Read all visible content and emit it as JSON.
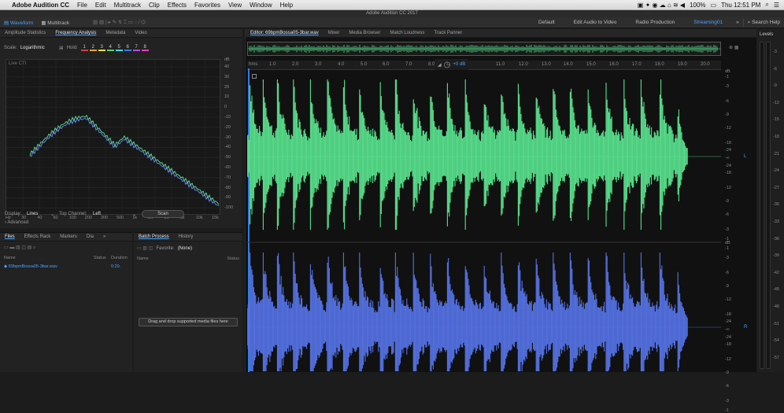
{
  "menubar": {
    "apple": "",
    "app": "Adobe Audition CC",
    "items": [
      "File",
      "Edit",
      "Multitrack",
      "Clip",
      "Effects",
      "Favorites",
      "View",
      "Window",
      "Help"
    ],
    "battery": "100%",
    "clock": "Thu 12:51 PM"
  },
  "window_title": "Adobe Audition CC 2017",
  "toolbar": {
    "waveform": "Waveform",
    "multitrack": "Multitrack",
    "workspaces": [
      "Default",
      "Edit Audio to Video",
      "Radio Production",
      "Streaming01"
    ],
    "active_workspace": "Streaming01",
    "search": "Search Help"
  },
  "freq": {
    "tabs": [
      "Amplitude Statistics",
      "Frequency Analysis",
      "Metadata",
      "Video"
    ],
    "selected": "Frequency Analysis",
    "scale_label": "Scale:",
    "scale_value": "Logarithmic",
    "hold_label": "Hold:",
    "hold_slots": [
      "1",
      "2",
      "3",
      "4",
      "5",
      "6",
      "7",
      "8"
    ],
    "hold_colors": [
      "#d93c3c",
      "#e8a23a",
      "#e8e23a",
      "#5fd35f",
      "#3adbe8",
      "#3a7be8",
      "#b44ae8",
      "#e83ab8"
    ],
    "live_label": "Live CTI",
    "db_unit": "dB",
    "db_ticks": [
      "40",
      "30",
      "20",
      "10",
      "0",
      "-10",
      "-20",
      "-30",
      "-40",
      "-50",
      "-60",
      "-70",
      "-80",
      "-90",
      "-100"
    ],
    "hz_ticks": [
      "Hz",
      "30",
      "40",
      "60",
      "100",
      "200",
      "300",
      "500",
      "1k",
      "2k",
      "3k",
      "5k",
      "10k",
      "15k"
    ],
    "display_label": "Display:",
    "display_value": "Lines",
    "channel_label": "Top Channel:",
    "channel_value": "Left",
    "scan": "Scan",
    "advanced": "Advanced"
  },
  "files": {
    "tabs": [
      "Files",
      "Effects Rack",
      "Markers",
      "Dia"
    ],
    "cols": [
      "Name",
      "Status",
      "Duration"
    ],
    "items": [
      {
        "name": "69bpmBossa05-3bar.wav",
        "duration": "0:20."
      }
    ]
  },
  "batch": {
    "tabs": [
      "Batch Process",
      "History"
    ],
    "favorite_label": "Favorite:",
    "favorite_value": "(None)",
    "cols": [
      "Name",
      "Status"
    ],
    "drop_hint": "Drag and drop supported media files here"
  },
  "editor": {
    "tabs": [
      "Editor: 69bpmBossa05-3bar.wav",
      "Mixer",
      "Media Browser",
      "Match Loudness",
      "Track Panner"
    ],
    "hms": "hms",
    "time_ticks": [
      "1.0",
      "2.0",
      "3.0",
      "4.0",
      "5.0",
      "6.0",
      "7.0",
      "8.0",
      "11.0",
      "12.0",
      "13.0",
      "14.0",
      "15.0",
      "16.0",
      "17.0",
      "18.0",
      "19.0",
      "20.0"
    ],
    "volume": "+0 dB",
    "db_scale": [
      "dB",
      "-1",
      "-3",
      "-6",
      "-9",
      "-12",
      "-18",
      "-24",
      "-∞",
      "-24",
      "-18",
      "-12",
      "-9",
      "-6",
      "-3",
      "-1"
    ],
    "channels": [
      {
        "label": "L",
        "color": "#59e38e"
      },
      {
        "label": "R",
        "color": "#5573e6"
      }
    ]
  },
  "levels": {
    "title": "Levels",
    "ticks": [
      "-3",
      "-6",
      "-9",
      "-12",
      "-15",
      "-18",
      "-21",
      "-24",
      "-27",
      "-30",
      "-33",
      "-36",
      "-39",
      "-42",
      "-45",
      "-48",
      "-51",
      "-54",
      "-57"
    ]
  }
}
